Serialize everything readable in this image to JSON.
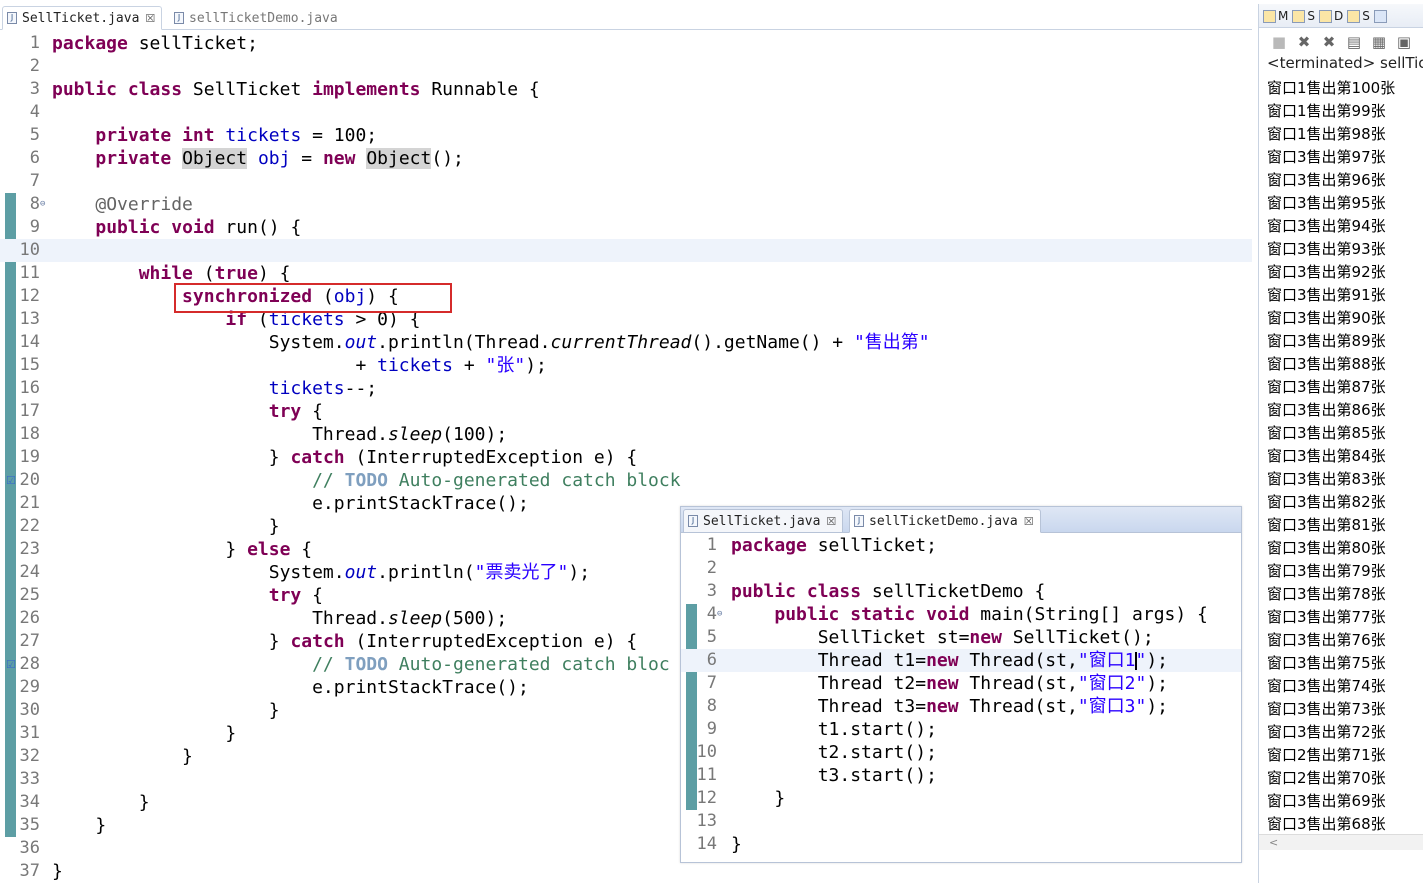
{
  "main_editor": {
    "tabs": [
      {
        "label": "SellTicket.java",
        "active": true,
        "closable": true
      },
      {
        "label": "sellTicketDemo.java",
        "active": false,
        "closable": false
      }
    ],
    "lines": [
      {
        "n": "1",
        "code": "package sellTicket;"
      },
      {
        "n": "2",
        "code": ""
      },
      {
        "n": "3",
        "code": "public class SellTicket implements Runnable {"
      },
      {
        "n": "4",
        "code": ""
      },
      {
        "n": "5",
        "code": "    private int tickets = 100;"
      },
      {
        "n": "6",
        "code": "    private Object obj = new Object();"
      },
      {
        "n": "7",
        "code": ""
      },
      {
        "n": "8",
        "code": "    @Override"
      },
      {
        "n": "9",
        "code": "    public void run() {"
      },
      {
        "n": "10",
        "code": ""
      },
      {
        "n": "11",
        "code": "        while (true) {"
      },
      {
        "n": "12",
        "code": "            synchronized (obj) {"
      },
      {
        "n": "13",
        "code": "                if (tickets > 0) {"
      },
      {
        "n": "14",
        "code": "                    System.out.println(Thread.currentThread().getName() + \"售出第\""
      },
      {
        "n": "15",
        "code": "                            + tickets + \"张\");"
      },
      {
        "n": "16",
        "code": "                    tickets--;"
      },
      {
        "n": "17",
        "code": "                    try {"
      },
      {
        "n": "18",
        "code": "                        Thread.sleep(100);"
      },
      {
        "n": "19",
        "code": "                    } catch (InterruptedException e) {"
      },
      {
        "n": "20",
        "code": "                        // TODO Auto-generated catch block"
      },
      {
        "n": "21",
        "code": "                        e.printStackTrace();"
      },
      {
        "n": "22",
        "code": "                    }"
      },
      {
        "n": "23",
        "code": "                } else {"
      },
      {
        "n": "24",
        "code": "                    System.out.println(\"票卖光了\");"
      },
      {
        "n": "25",
        "code": "                    try {"
      },
      {
        "n": "26",
        "code": "                        Thread.sleep(500);"
      },
      {
        "n": "27",
        "code": "                    } catch (InterruptedException e) {"
      },
      {
        "n": "28",
        "code": "                        // TODO Auto-generated catch bloc"
      },
      {
        "n": "29",
        "code": "                        e.printStackTrace();"
      },
      {
        "n": "30",
        "code": "                    }"
      },
      {
        "n": "31",
        "code": "                }"
      },
      {
        "n": "32",
        "code": "            }"
      },
      {
        "n": "33",
        "code": ""
      },
      {
        "n": "34",
        "code": "        }"
      },
      {
        "n": "35",
        "code": "    }"
      },
      {
        "n": "36",
        "code": ""
      },
      {
        "n": "37",
        "code": "}"
      }
    ],
    "tokens": {
      "package": "package",
      "pkg_name": "sellTicket;",
      "public": "public",
      "class": "class",
      "class_name": "SellTicket",
      "implements": "implements",
      "runnable": "Runnable {",
      "private": "private",
      "int": "int",
      "tickets": "tickets",
      "eq100": " = 100;",
      "object": "Object",
      "obj": "obj",
      "eq": " = ",
      "new": "new",
      "object_call": "Object",
      "call_end": "();",
      "override": "@Override",
      "void": "void",
      "run_sig": " run() {",
      "while": "while",
      "true": "true",
      "while_open": " (",
      "while_close": ") {",
      "synchronized": "synchronized",
      "sync_open": " (",
      "sync_close": ") {",
      "if": "if",
      "if_open": " (",
      "if_close": " > 0) {",
      "system": "System.",
      "out": "out",
      "println_a": ".println(Thread.",
      "current_thread": "currentThread",
      "get_name": "().getName() + ",
      "str_sold": "\"售出第\"",
      "plus": "+ ",
      "plus2": " + ",
      "str_zhang": "\"张\"",
      "close_paren": ");",
      "decrement": "--;",
      "try": "try",
      "brace_open": " {",
      "thread": "Thread.",
      "sleep": "sleep",
      "sleep100": "(100);",
      "brace_close": "} ",
      "catch": "catch",
      "catch_sig": " (InterruptedException e) {",
      "comment_slash": "// ",
      "todo": "TODO",
      "comment_rest": " Auto-generated catch block",
      "comment_rest_cut": " Auto-generated catch bloc",
      "print_trace": "e.printStackTrace();",
      "else": "else",
      "println_b": ".println(",
      "str_sold_out": "\"票卖光了\"",
      "sleep500": "(500);",
      "brace": "}"
    }
  },
  "console": {
    "tab_labels": [
      "M",
      "S",
      "D",
      "S"
    ],
    "status": "<terminated> sellTick",
    "output": [
      "窗口1售出第100张",
      "窗口1售出第99张",
      "窗口1售出第98张",
      "窗口3售出第97张",
      "窗口3售出第96张",
      "窗口3售出第95张",
      "窗口3售出第94张",
      "窗口3售出第93张",
      "窗口3售出第92张",
      "窗口3售出第91张",
      "窗口3售出第90张",
      "窗口3售出第89张",
      "窗口3售出第88张",
      "窗口3售出第87张",
      "窗口3售出第86张",
      "窗口3售出第85张",
      "窗口3售出第84张",
      "窗口3售出第83张",
      "窗口3售出第82张",
      "窗口3售出第81张",
      "窗口3售出第80张",
      "窗口3售出第79张",
      "窗口3售出第78张",
      "窗口3售出第77张",
      "窗口3售出第76张",
      "窗口3售出第75张",
      "窗口3售出第74张",
      "窗口3售出第73张",
      "窗口3售出第72张",
      "窗口2售出第71张",
      "窗口2售出第70张",
      "窗口3售出第69张",
      "窗口3售出第68张"
    ]
  },
  "demo_editor": {
    "tabs": [
      {
        "label": "SellTicket.java",
        "active": false
      },
      {
        "label": "sellTicketDemo.java",
        "active": true
      }
    ],
    "lines": [
      {
        "n": "1"
      },
      {
        "n": "2"
      },
      {
        "n": "3"
      },
      {
        "n": "4"
      },
      {
        "n": "5"
      },
      {
        "n": "6"
      },
      {
        "n": "7"
      },
      {
        "n": "8"
      },
      {
        "n": "9"
      },
      {
        "n": "10"
      },
      {
        "n": "11"
      },
      {
        "n": "12"
      },
      {
        "n": "13"
      },
      {
        "n": "14"
      }
    ],
    "tokens": {
      "package": "package",
      "pkg_name": " sellTicket;",
      "public": "public",
      "class": "class",
      "class_name": " sellTicketDemo {",
      "static": "static",
      "void": "void",
      "main_sig": " main(String[] args) {",
      "st_decl": "SellTicket st=",
      "new": "new",
      "st_ctor": " SellTicket();",
      "t1_decl": "Thread t1=",
      "t2_decl": "Thread t2=",
      "t3_decl": "Thread t3=",
      "thread_ctor": " Thread(st,",
      "win1": "\"窗口1",
      "win1_end": "\"",
      "win2": "\"窗口2\"",
      "win3": "\"窗口3\"",
      "close_paren": ");",
      "t1_start": "t1.start();",
      "t2_start": "t2.start();",
      "t3_start": "t3.start();",
      "brace": "}"
    }
  },
  "colors": {
    "keyword": "#7f0055",
    "field": "#0000c0",
    "string": "#2a00ff",
    "comment": "#3f7f5f",
    "todo": "#7f9fbf",
    "gutter_change": "#5d9ea4",
    "highlight_box": "#d52b2b",
    "current_line": "#eef3fb"
  }
}
